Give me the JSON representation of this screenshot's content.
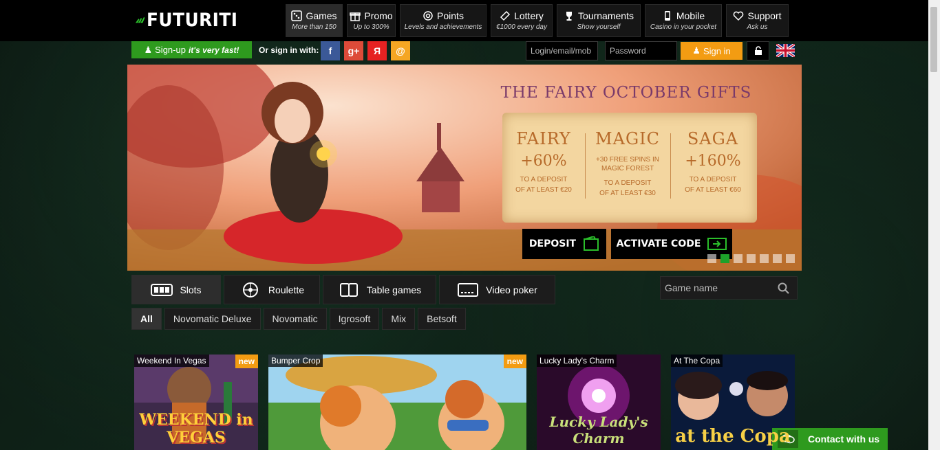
{
  "brand": {
    "name": "FUTURITI"
  },
  "nav": [
    {
      "label": "Games",
      "sub": "More than 150",
      "icon": "dice-icon"
    },
    {
      "label": "Promo",
      "sub": "Up to 300%",
      "icon": "gift-icon"
    },
    {
      "label": "Points",
      "sub": "Levels and achievements",
      "icon": "target-icon"
    },
    {
      "label": "Lottery",
      "sub": "€1000 every day",
      "icon": "ticket-icon"
    },
    {
      "label": "Tournaments",
      "sub": "Show yourself",
      "icon": "trophy-icon"
    },
    {
      "label": "Mobile",
      "sub": "Casino in your pocket",
      "icon": "phone-icon"
    },
    {
      "label": "Support",
      "sub": "Ask us",
      "icon": "heart-icon"
    }
  ],
  "auth": {
    "signup_label": "Sign-up",
    "signup_tagline": "it's very fast!",
    "or_sign_in_with": "Or sign in with:",
    "social": [
      {
        "label": "f",
        "color": "#3b5998",
        "name": "facebook"
      },
      {
        "label": "g+",
        "color": "#dd4b39",
        "name": "google-plus"
      },
      {
        "label": "Я",
        "color": "#e62222",
        "name": "yandex"
      },
      {
        "label": "@",
        "color": "#f5a623",
        "name": "mail"
      }
    ],
    "login_placeholder": "Login/email/mob",
    "password_placeholder": "Password",
    "signin_label": "Sign in"
  },
  "banner": {
    "title": "THE FAIRY OCTOBER GIFTS",
    "offers": [
      {
        "name": "FAIRY",
        "value": "+60%",
        "extra": "",
        "deposit_line1": "TO A DEPOSIT",
        "deposit_line2": "OF AT LEAST €20"
      },
      {
        "name": "MAGIC",
        "value": "",
        "extra": "+30 FREE SPINS IN MAGIC FOREST",
        "deposit_line1": "TO A DEPOSIT",
        "deposit_line2": "OF AT LEAST €30"
      },
      {
        "name": "SAGA",
        "value": "+160%",
        "extra": "",
        "deposit_line1": "TO A DEPOSIT",
        "deposit_line2": "OF AT LEAST €60"
      }
    ],
    "deposit_label": "DEPOSIT",
    "activate_label": "ACTIVATE CODE",
    "slides_total": 7,
    "slide_active_index": 1
  },
  "categories": [
    {
      "label": "Slots",
      "icon": "slot-machine-icon",
      "active": true
    },
    {
      "label": "Roulette",
      "icon": "roulette-icon",
      "active": false
    },
    {
      "label": "Table games",
      "icon": "cards-icon",
      "active": false
    },
    {
      "label": "Video poker",
      "icon": "video-poker-icon",
      "active": false
    }
  ],
  "search": {
    "placeholder": "Game name"
  },
  "providers": [
    "All",
    "Novomatic Deluxe",
    "Novomatic",
    "Igrosoft",
    "Mix",
    "Betsoft"
  ],
  "games": [
    {
      "title": "Weekend In Vegas",
      "badge": "new",
      "art_text": "WEEKEND in VEGAS"
    },
    {
      "title": "Bumper Crop",
      "badge": "new",
      "art_text": ""
    },
    {
      "title": "Lucky Lady's Charm",
      "badge": "",
      "art_text": "Lucky Lady's Charm"
    },
    {
      "title": "At The Copa",
      "badge": "",
      "art_text": "at the Copa"
    }
  ],
  "contact": {
    "label": "Contact with us"
  },
  "colors": {
    "accent_green": "#2e9a1e",
    "accent_orange": "#f39c12"
  }
}
